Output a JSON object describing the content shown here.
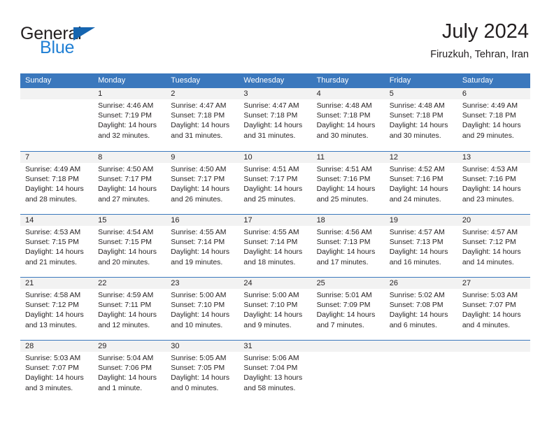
{
  "brand": {
    "name_dark": "General",
    "name_blue": "Blue",
    "triangle_color": "#1565b0",
    "blue_color": "#1f7fd4"
  },
  "header": {
    "title": "July 2024",
    "subtitle": "Firuzkuh, Tehran, Iran"
  },
  "theme": {
    "header_bg": "#3b78bd",
    "header_text": "#ffffff",
    "daynum_strip_bg": "#f2f2f2",
    "cell_bg": "#ffffff",
    "text": "#231f20"
  },
  "calendar": {
    "weekdays": [
      "Sunday",
      "Monday",
      "Tuesday",
      "Wednesday",
      "Thursday",
      "Friday",
      "Saturday"
    ],
    "weeks": [
      [
        {
          "day": ""
        },
        {
          "day": "1",
          "sunrise": "Sunrise: 4:46 AM",
          "sunset": "Sunset: 7:19 PM",
          "daylight_line1": "Daylight: 14 hours",
          "daylight_line2": "and 32 minutes."
        },
        {
          "day": "2",
          "sunrise": "Sunrise: 4:47 AM",
          "sunset": "Sunset: 7:18 PM",
          "daylight_line1": "Daylight: 14 hours",
          "daylight_line2": "and 31 minutes."
        },
        {
          "day": "3",
          "sunrise": "Sunrise: 4:47 AM",
          "sunset": "Sunset: 7:18 PM",
          "daylight_line1": "Daylight: 14 hours",
          "daylight_line2": "and 31 minutes."
        },
        {
          "day": "4",
          "sunrise": "Sunrise: 4:48 AM",
          "sunset": "Sunset: 7:18 PM",
          "daylight_line1": "Daylight: 14 hours",
          "daylight_line2": "and 30 minutes."
        },
        {
          "day": "5",
          "sunrise": "Sunrise: 4:48 AM",
          "sunset": "Sunset: 7:18 PM",
          "daylight_line1": "Daylight: 14 hours",
          "daylight_line2": "and 30 minutes."
        },
        {
          "day": "6",
          "sunrise": "Sunrise: 4:49 AM",
          "sunset": "Sunset: 7:18 PM",
          "daylight_line1": "Daylight: 14 hours",
          "daylight_line2": "and 29 minutes."
        }
      ],
      [
        {
          "day": "7",
          "sunrise": "Sunrise: 4:49 AM",
          "sunset": "Sunset: 7:18 PM",
          "daylight_line1": "Daylight: 14 hours",
          "daylight_line2": "and 28 minutes."
        },
        {
          "day": "8",
          "sunrise": "Sunrise: 4:50 AM",
          "sunset": "Sunset: 7:17 PM",
          "daylight_line1": "Daylight: 14 hours",
          "daylight_line2": "and 27 minutes."
        },
        {
          "day": "9",
          "sunrise": "Sunrise: 4:50 AM",
          "sunset": "Sunset: 7:17 PM",
          "daylight_line1": "Daylight: 14 hours",
          "daylight_line2": "and 26 minutes."
        },
        {
          "day": "10",
          "sunrise": "Sunrise: 4:51 AM",
          "sunset": "Sunset: 7:17 PM",
          "daylight_line1": "Daylight: 14 hours",
          "daylight_line2": "and 25 minutes."
        },
        {
          "day": "11",
          "sunrise": "Sunrise: 4:51 AM",
          "sunset": "Sunset: 7:16 PM",
          "daylight_line1": "Daylight: 14 hours",
          "daylight_line2": "and 25 minutes."
        },
        {
          "day": "12",
          "sunrise": "Sunrise: 4:52 AM",
          "sunset": "Sunset: 7:16 PM",
          "daylight_line1": "Daylight: 14 hours",
          "daylight_line2": "and 24 minutes."
        },
        {
          "day": "13",
          "sunrise": "Sunrise: 4:53 AM",
          "sunset": "Sunset: 7:16 PM",
          "daylight_line1": "Daylight: 14 hours",
          "daylight_line2": "and 23 minutes."
        }
      ],
      [
        {
          "day": "14",
          "sunrise": "Sunrise: 4:53 AM",
          "sunset": "Sunset: 7:15 PM",
          "daylight_line1": "Daylight: 14 hours",
          "daylight_line2": "and 21 minutes."
        },
        {
          "day": "15",
          "sunrise": "Sunrise: 4:54 AM",
          "sunset": "Sunset: 7:15 PM",
          "daylight_line1": "Daylight: 14 hours",
          "daylight_line2": "and 20 minutes."
        },
        {
          "day": "16",
          "sunrise": "Sunrise: 4:55 AM",
          "sunset": "Sunset: 7:14 PM",
          "daylight_line1": "Daylight: 14 hours",
          "daylight_line2": "and 19 minutes."
        },
        {
          "day": "17",
          "sunrise": "Sunrise: 4:55 AM",
          "sunset": "Sunset: 7:14 PM",
          "daylight_line1": "Daylight: 14 hours",
          "daylight_line2": "and 18 minutes."
        },
        {
          "day": "18",
          "sunrise": "Sunrise: 4:56 AM",
          "sunset": "Sunset: 7:13 PM",
          "daylight_line1": "Daylight: 14 hours",
          "daylight_line2": "and 17 minutes."
        },
        {
          "day": "19",
          "sunrise": "Sunrise: 4:57 AM",
          "sunset": "Sunset: 7:13 PM",
          "daylight_line1": "Daylight: 14 hours",
          "daylight_line2": "and 16 minutes."
        },
        {
          "day": "20",
          "sunrise": "Sunrise: 4:57 AM",
          "sunset": "Sunset: 7:12 PM",
          "daylight_line1": "Daylight: 14 hours",
          "daylight_line2": "and 14 minutes."
        }
      ],
      [
        {
          "day": "21",
          "sunrise": "Sunrise: 4:58 AM",
          "sunset": "Sunset: 7:12 PM",
          "daylight_line1": "Daylight: 14 hours",
          "daylight_line2": "and 13 minutes."
        },
        {
          "day": "22",
          "sunrise": "Sunrise: 4:59 AM",
          "sunset": "Sunset: 7:11 PM",
          "daylight_line1": "Daylight: 14 hours",
          "daylight_line2": "and 12 minutes."
        },
        {
          "day": "23",
          "sunrise": "Sunrise: 5:00 AM",
          "sunset": "Sunset: 7:10 PM",
          "daylight_line1": "Daylight: 14 hours",
          "daylight_line2": "and 10 minutes."
        },
        {
          "day": "24",
          "sunrise": "Sunrise: 5:00 AM",
          "sunset": "Sunset: 7:10 PM",
          "daylight_line1": "Daylight: 14 hours",
          "daylight_line2": "and 9 minutes."
        },
        {
          "day": "25",
          "sunrise": "Sunrise: 5:01 AM",
          "sunset": "Sunset: 7:09 PM",
          "daylight_line1": "Daylight: 14 hours",
          "daylight_line2": "and 7 minutes."
        },
        {
          "day": "26",
          "sunrise": "Sunrise: 5:02 AM",
          "sunset": "Sunset: 7:08 PM",
          "daylight_line1": "Daylight: 14 hours",
          "daylight_line2": "and 6 minutes."
        },
        {
          "day": "27",
          "sunrise": "Sunrise: 5:03 AM",
          "sunset": "Sunset: 7:07 PM",
          "daylight_line1": "Daylight: 14 hours",
          "daylight_line2": "and 4 minutes."
        }
      ],
      [
        {
          "day": "28",
          "sunrise": "Sunrise: 5:03 AM",
          "sunset": "Sunset: 7:07 PM",
          "daylight_line1": "Daylight: 14 hours",
          "daylight_line2": "and 3 minutes."
        },
        {
          "day": "29",
          "sunrise": "Sunrise: 5:04 AM",
          "sunset": "Sunset: 7:06 PM",
          "daylight_line1": "Daylight: 14 hours",
          "daylight_line2": "and 1 minute."
        },
        {
          "day": "30",
          "sunrise": "Sunrise: 5:05 AM",
          "sunset": "Sunset: 7:05 PM",
          "daylight_line1": "Daylight: 14 hours",
          "daylight_line2": "and 0 minutes."
        },
        {
          "day": "31",
          "sunrise": "Sunrise: 5:06 AM",
          "sunset": "Sunset: 7:04 PM",
          "daylight_line1": "Daylight: 13 hours",
          "daylight_line2": "and 58 minutes."
        },
        {
          "day": ""
        },
        {
          "day": ""
        },
        {
          "day": ""
        }
      ]
    ]
  }
}
